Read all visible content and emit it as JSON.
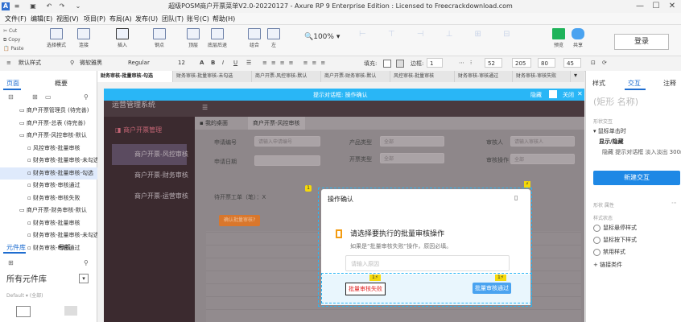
{
  "window": {
    "title": "超级POSM商户开票菜单V2.0-20220127 - Axure RP 9 Enterprise Edition : Licensed to Freecrackdownload.com",
    "logo": "A"
  },
  "menu": [
    "文件(F)",
    "编辑(E)",
    "视图(V)",
    "项目(P)",
    "布局(A)",
    "发布(U)",
    "团队(T)",
    "账号(C)",
    "帮助(H)"
  ],
  "clipboard": {
    "cut": "Cut",
    "copy": "Copy",
    "paste": "Paste"
  },
  "toolbar": {
    "select_mode": "选择模式",
    "connect": "连接",
    "insert": "插入",
    "point": "钢点",
    "top": "顶层",
    "back": "底层后退",
    "combine": "组合",
    "left": "左",
    "zoom": "100%",
    "preview": "预览",
    "share": "共享",
    "login": "登录"
  },
  "format": {
    "style": "默认样式",
    "font": "微软雅黑",
    "weight": "Regular",
    "size": "12",
    "fill_label": "填充:",
    "border_label": "边框:",
    "border_width": "1",
    "x": "52",
    "y": "205",
    "w": "80",
    "h": "45"
  },
  "left_panel": {
    "tabs": [
      "页面",
      "概要"
    ],
    "tree": [
      {
        "label": "商户开票管理员 (待完善)",
        "indent": 1
      },
      {
        "label": "商户开票-总表 (待完善)",
        "indent": 1
      },
      {
        "label": "商户开票-风控审核-默认",
        "indent": 1
      },
      {
        "label": "风控审核-批量审核",
        "indent": 2
      },
      {
        "label": "财务审核-批量审核-未勾选",
        "indent": 2
      },
      {
        "label": "财务审核-批量审核-勾选",
        "indent": 2
      },
      {
        "label": "财务审核-审核通过",
        "indent": 2
      },
      {
        "label": "财务审核-审核失败",
        "indent": 2
      },
      {
        "label": "商户开票-财务审核-默认",
        "indent": 1
      },
      {
        "label": "财务审核-批量审核",
        "indent": 2
      },
      {
        "label": "财务审核-批量审核-未勾选",
        "indent": 2
      },
      {
        "label": "财务审核-审核通过",
        "indent": 2
      }
    ],
    "lib_tabs": [
      "元件库",
      "母版"
    ],
    "lib_dropdown": "所有元件库",
    "lib_default": "Default ▾ (全部)"
  },
  "doc_tabs": [
    "财务审核-批量审核-勾选",
    "财务审核-批量审核-未勾选",
    "商户开票-风控审核-默认",
    "商户开票-财务审核-默认",
    "风控审核-批量审核",
    "财务审核-审核通过",
    "财务审核-审核失败"
  ],
  "canvas": {
    "selection_bar": "提示对话框: 操作确认",
    "hide": "隐藏",
    "close": "关闭",
    "app_title": "运营管理系统",
    "side_menu": [
      "商户开票管理",
      "商户开票-风控审核",
      "商户开票-财务审核",
      "商户开票-运营审核"
    ],
    "breadcrumb_home": "我的桌面",
    "breadcrumb_tab": "商户开票-风控审核",
    "fields": {
      "apply_no": "申请编号",
      "apply_no_placeholder": "请输入申请编号",
      "product_type": "产品类型",
      "product_type_value": "全部",
      "auditor": "审核人",
      "auditor_value": "请输入审核人",
      "apply_date": "申请日期",
      "open_type": "开票类型",
      "open_type_value": "全部",
      "audit_op": "审核操作",
      "audit_op_value": "全部"
    },
    "pending_label": "待开票工单（笔）：X",
    "batch_button": "确认批量审核?"
  },
  "dialog": {
    "title": "操作确认",
    "heading": "请选择要执行的批量审核操作",
    "desc": "如果是“批量审核失败”操作，原因必填。",
    "reason_placeholder": "请输入原因",
    "fail_button": "批量审核失败",
    "pass_button": "批量审核通过",
    "badge": "1"
  },
  "right_panel": {
    "tabs": [
      "样式",
      "交互",
      "注释"
    ],
    "shape_name": "(矩形 名称)",
    "section_interaction": "形状交互",
    "event": "鼠标单击时",
    "action_show_hide": "显示/隐藏",
    "action_detail": "隐藏 提示对话框 淡入淡出 300ms",
    "new_interaction": "新建交互",
    "shape_props": "形状 属性",
    "style_state": "样式状态",
    "states": [
      "鼠标悬停样式",
      "鼠标按下样式",
      "禁用样式"
    ],
    "link": "链接类件"
  },
  "colors": {
    "accent": "#1e88e5",
    "selection": "#29b6f6",
    "canvas_bg": "#7a7277",
    "side_menu": "#3b2a2f",
    "dialog_orange": "#f39c12"
  }
}
